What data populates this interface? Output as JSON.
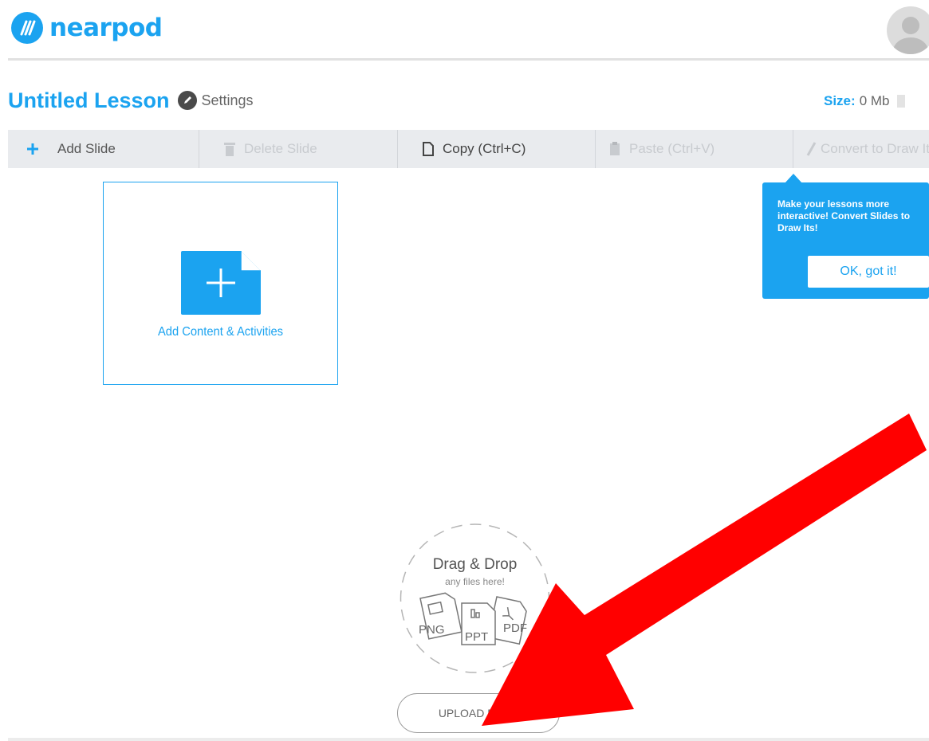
{
  "header": {
    "brand": "nearpod"
  },
  "lesson": {
    "title": "Untitled Lesson",
    "settings_label": "Settings",
    "size_label": "Size:",
    "size_value": "0 Mb"
  },
  "toolbar": {
    "add_slide": "Add Slide",
    "delete_slide": "Delete Slide",
    "copy": "Copy (Ctrl+C)",
    "paste": "Paste (Ctrl+V)",
    "convert": "Convert to Draw It"
  },
  "tooltip": {
    "message": "Make your lessons more interactive! Convert Slides to Draw Its!",
    "ok_label": "OK, got it!"
  },
  "add_content": {
    "label": "Add Content & Activities"
  },
  "dropzone": {
    "title": "Drag & Drop",
    "subtitle": "any files here!",
    "file_types": [
      "PNG",
      "PPT",
      "PDF"
    ]
  },
  "upload": {
    "label": "UPLOAD FILES"
  },
  "colors": {
    "brand": "#1ba3f0",
    "toolbar_bg": "#e9ebee",
    "annotation_arrow": "#ff0000"
  }
}
